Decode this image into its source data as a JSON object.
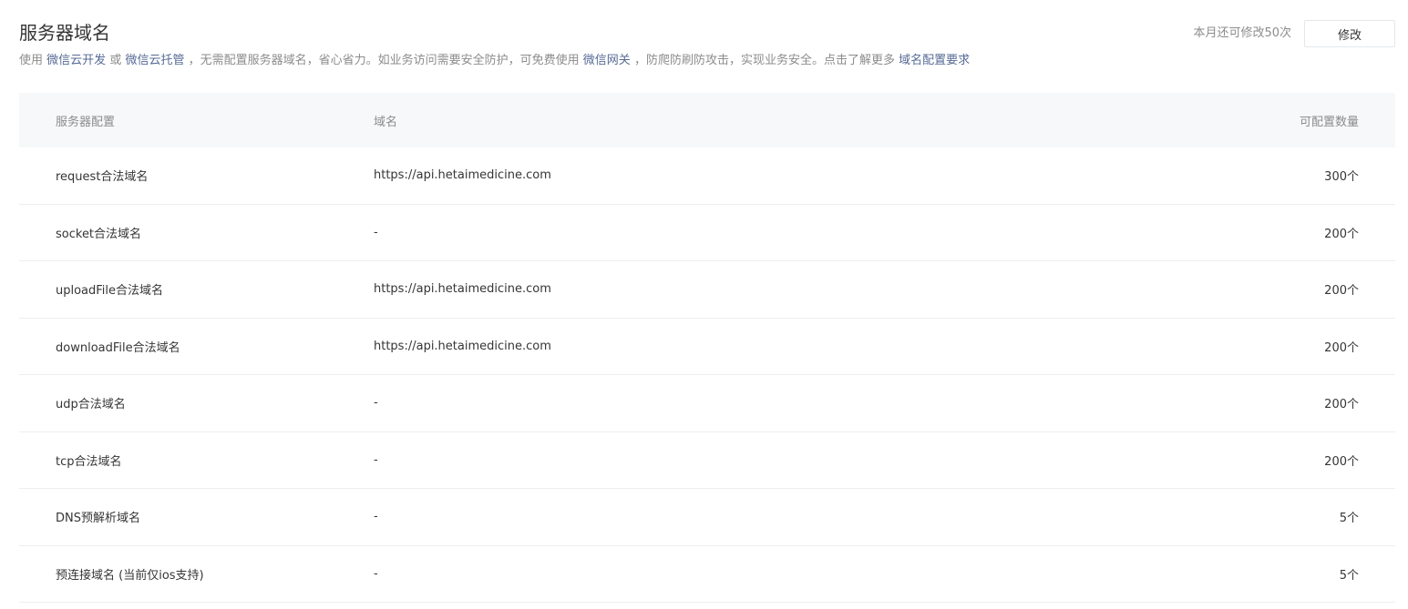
{
  "header": {
    "title": "服务器域名",
    "description": {
      "prefix": "使用",
      "link_cloud_dev": "微信云开发",
      "or": "或",
      "link_cloud_hosting": "微信云托管",
      "middle": "，无需配置服务器域名，省心省力。如业务访问需要安全防护，可免费使用",
      "link_gateway": "微信网关",
      "suffix": "，防爬防刷防攻击，实现业务安全。点击了解更多",
      "link_requirements": "域名配置要求"
    },
    "quota_text": "本月还可修改50次",
    "edit_button_label": "修改"
  },
  "table": {
    "columns": {
      "config": "服务器配置",
      "domain": "域名",
      "count": "可配置数量"
    },
    "rows": [
      {
        "config": "request合法域名",
        "domain": "https://api.hetaimedicine.com",
        "count": "300个"
      },
      {
        "config": "socket合法域名",
        "domain": "-",
        "count": "200个"
      },
      {
        "config": "uploadFile合法域名",
        "domain": "https://api.hetaimedicine.com",
        "count": "200个"
      },
      {
        "config": "downloadFile合法域名",
        "domain": "https://api.hetaimedicine.com",
        "count": "200个"
      },
      {
        "config": "udp合法域名",
        "domain": "-",
        "count": "200个"
      },
      {
        "config": "tcp合法域名",
        "domain": "-",
        "count": "200个"
      },
      {
        "config": "DNS预解析域名",
        "domain": "-",
        "count": "5个"
      },
      {
        "config": "预连接域名 (当前仅ios支持)",
        "domain": "-",
        "count": "5个"
      }
    ]
  },
  "colors": {
    "link": "#576b95",
    "muted_text": "#8c8c8c",
    "text": "#353535",
    "table_head_bg": "#f6f8f9",
    "divider": "#eceeef"
  }
}
